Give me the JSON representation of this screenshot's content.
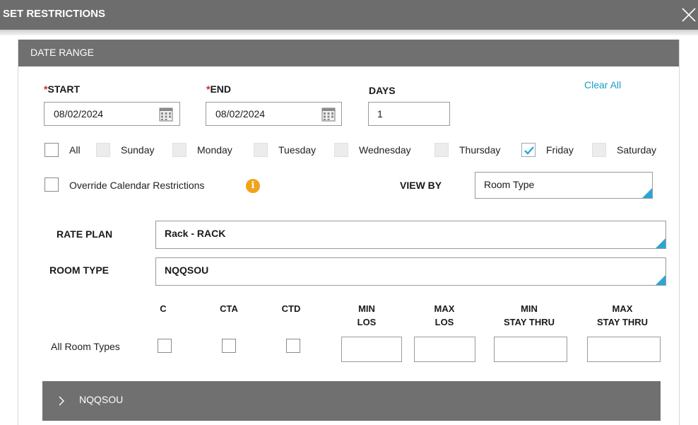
{
  "dialog": {
    "title": "SET RESTRICTIONS"
  },
  "date_range": {
    "header": "DATE RANGE",
    "start_required": "*",
    "start_label": "START",
    "end_required": "*",
    "end_label": "END",
    "days_label": "DAYS",
    "clear_all": "Clear All",
    "start_value": "08/02/2024",
    "end_value": "08/02/2024",
    "days_value": "1"
  },
  "weekdays": {
    "all": "All",
    "sunday": "Sunday",
    "monday": "Monday",
    "tuesday": "Tuesday",
    "wednesday": "Wednesday",
    "thursday": "Thursday",
    "friday": "Friday",
    "saturday": "Saturday"
  },
  "override": {
    "label": "Override Calendar Restrictions",
    "info_glyph": "i"
  },
  "view_by": {
    "label": "VIEW BY",
    "value": "Room Type"
  },
  "rate_plan": {
    "label": "RATE PLAN",
    "value": "Rack - RACK"
  },
  "room_type": {
    "label": "ROOM TYPE",
    "value": "NQQSOU"
  },
  "restrictions": {
    "col_c": "C",
    "col_cta": "CTA",
    "col_ctd": "CTD",
    "col_min_los_1": "MIN",
    "col_min_los_2": "LOS",
    "col_max_los_1": "MAX",
    "col_max_los_2": "LOS",
    "col_min_stay_1": "MIN",
    "col_min_stay_2": "STAY  THRU",
    "col_max_stay_1": "MAX",
    "col_max_stay_2": "STAY  THRU",
    "row_label": "All Room Types"
  },
  "accordion": {
    "label": "NQQSOU"
  },
  "colors": {
    "header_gray": "#707070",
    "accent_blue": "#2aa6d6",
    "link_blue": "#1a9cc7",
    "required_red": "#d0252b",
    "info_orange": "#f0a41c"
  }
}
